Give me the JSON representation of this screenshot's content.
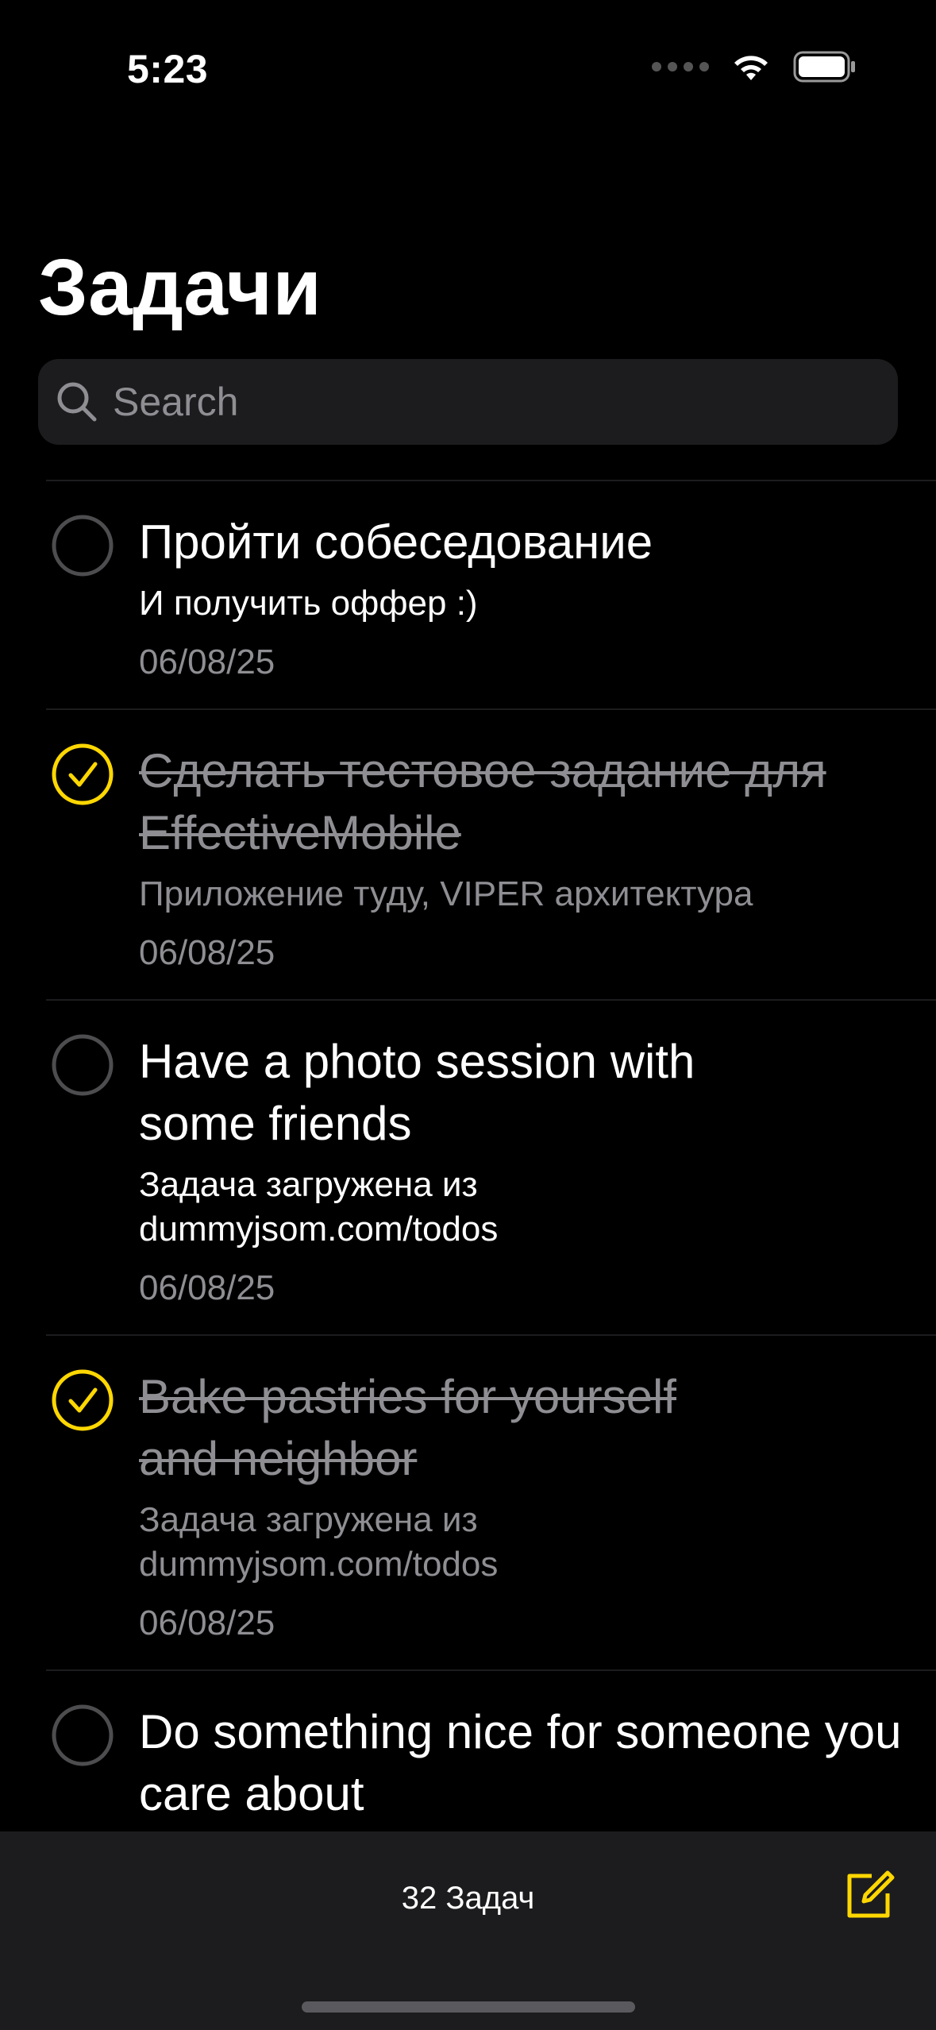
{
  "status_bar": {
    "time": "5:23",
    "icons": [
      "signal-dots-icon",
      "wifi-icon",
      "battery-icon"
    ]
  },
  "header": {
    "title": "Задачи"
  },
  "search": {
    "placeholder": "Search",
    "value": "",
    "icon": "search-icon"
  },
  "tasks": [
    {
      "title": "Пройти собеседование",
      "description": "И получить оффер :)",
      "date": "06/08/25",
      "completed": false
    },
    {
      "title": "Сделать тестовое задание для EffectiveMobile",
      "description": "Приложение туду, VIPER архитектура",
      "date": "06/08/25",
      "completed": true
    },
    {
      "title": "Have a photo session with some friends",
      "description": "Задача загружена из dummyjsom.com/todos",
      "date": "06/08/25",
      "completed": false
    },
    {
      "title": "Bake pastries for yourself and neighbor",
      "description": "Задача загружена из dummyjsom.com/todos",
      "date": "06/08/25",
      "completed": true
    },
    {
      "title": "Do something nice for someone you care about",
      "description": "",
      "date": "",
      "completed": false
    }
  ],
  "toolbar": {
    "count_label": "32 Задач",
    "compose_icon": "compose-icon"
  },
  "colors": {
    "accent": "#FED702",
    "background": "#000000",
    "secondary_text": "#8E8E93",
    "surface": "#1C1C1E"
  }
}
